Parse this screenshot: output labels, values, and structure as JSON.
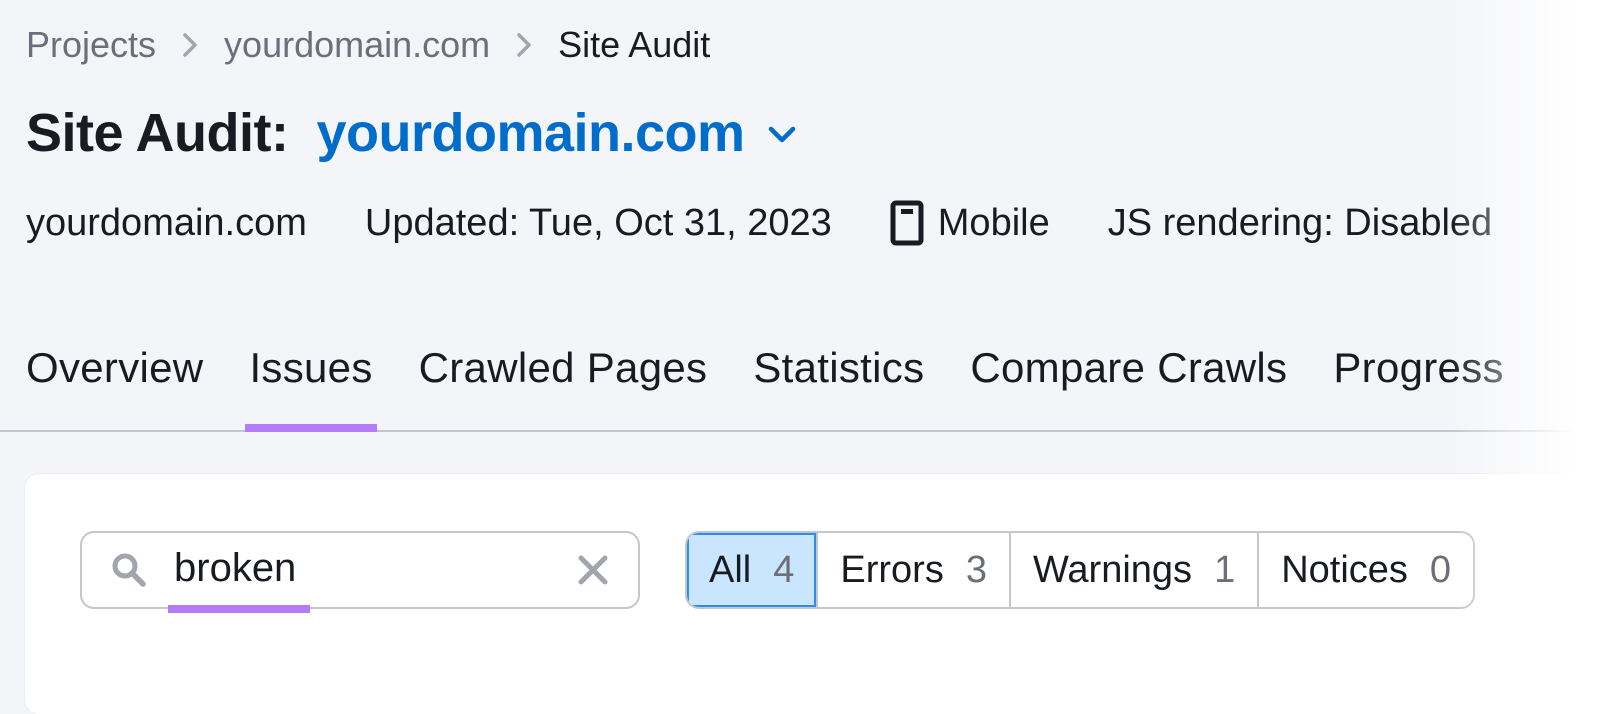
{
  "breadcrumb": {
    "items": [
      {
        "label": "Projects"
      },
      {
        "label": "yourdomain.com"
      },
      {
        "label": "Site Audit"
      }
    ],
    "separator_icon": "chevron-right-icon"
  },
  "header": {
    "title_label": "Site Audit:",
    "project_domain": "yourdomain.com",
    "dropdown_icon": "chevron-down-icon"
  },
  "meta": {
    "domain": "yourdomain.com",
    "updated": "Updated: Tue, Oct 31, 2023",
    "device_icon": "mobile-device-icon",
    "device": "Mobile",
    "js_rendering": "JS rendering: Disabled"
  },
  "tabs": [
    {
      "label": "Overview",
      "active": false
    },
    {
      "label": "Issues",
      "active": true
    },
    {
      "label": "Crawled Pages",
      "active": false
    },
    {
      "label": "Statistics",
      "active": false
    },
    {
      "label": "Compare Crawls",
      "active": false
    },
    {
      "label": "Progress",
      "active": false
    }
  ],
  "search": {
    "value": "broken",
    "icon": "search-icon",
    "clear_icon": "close-icon"
  },
  "filters": [
    {
      "label": "All",
      "count": "4",
      "active": true
    },
    {
      "label": "Errors",
      "count": "3",
      "active": false
    },
    {
      "label": "Warnings",
      "count": "1",
      "active": false
    },
    {
      "label": "Notices",
      "count": "0",
      "active": false
    }
  ],
  "colors": {
    "background": "#f4f5f9",
    "link_blue": "#006dca",
    "accent_purple": "#b57cf8",
    "active_filter_bg": "#c9e6fe",
    "active_filter_border": "#2b8ee8",
    "text_primary": "#191b23",
    "text_secondary": "#6c6e79"
  }
}
